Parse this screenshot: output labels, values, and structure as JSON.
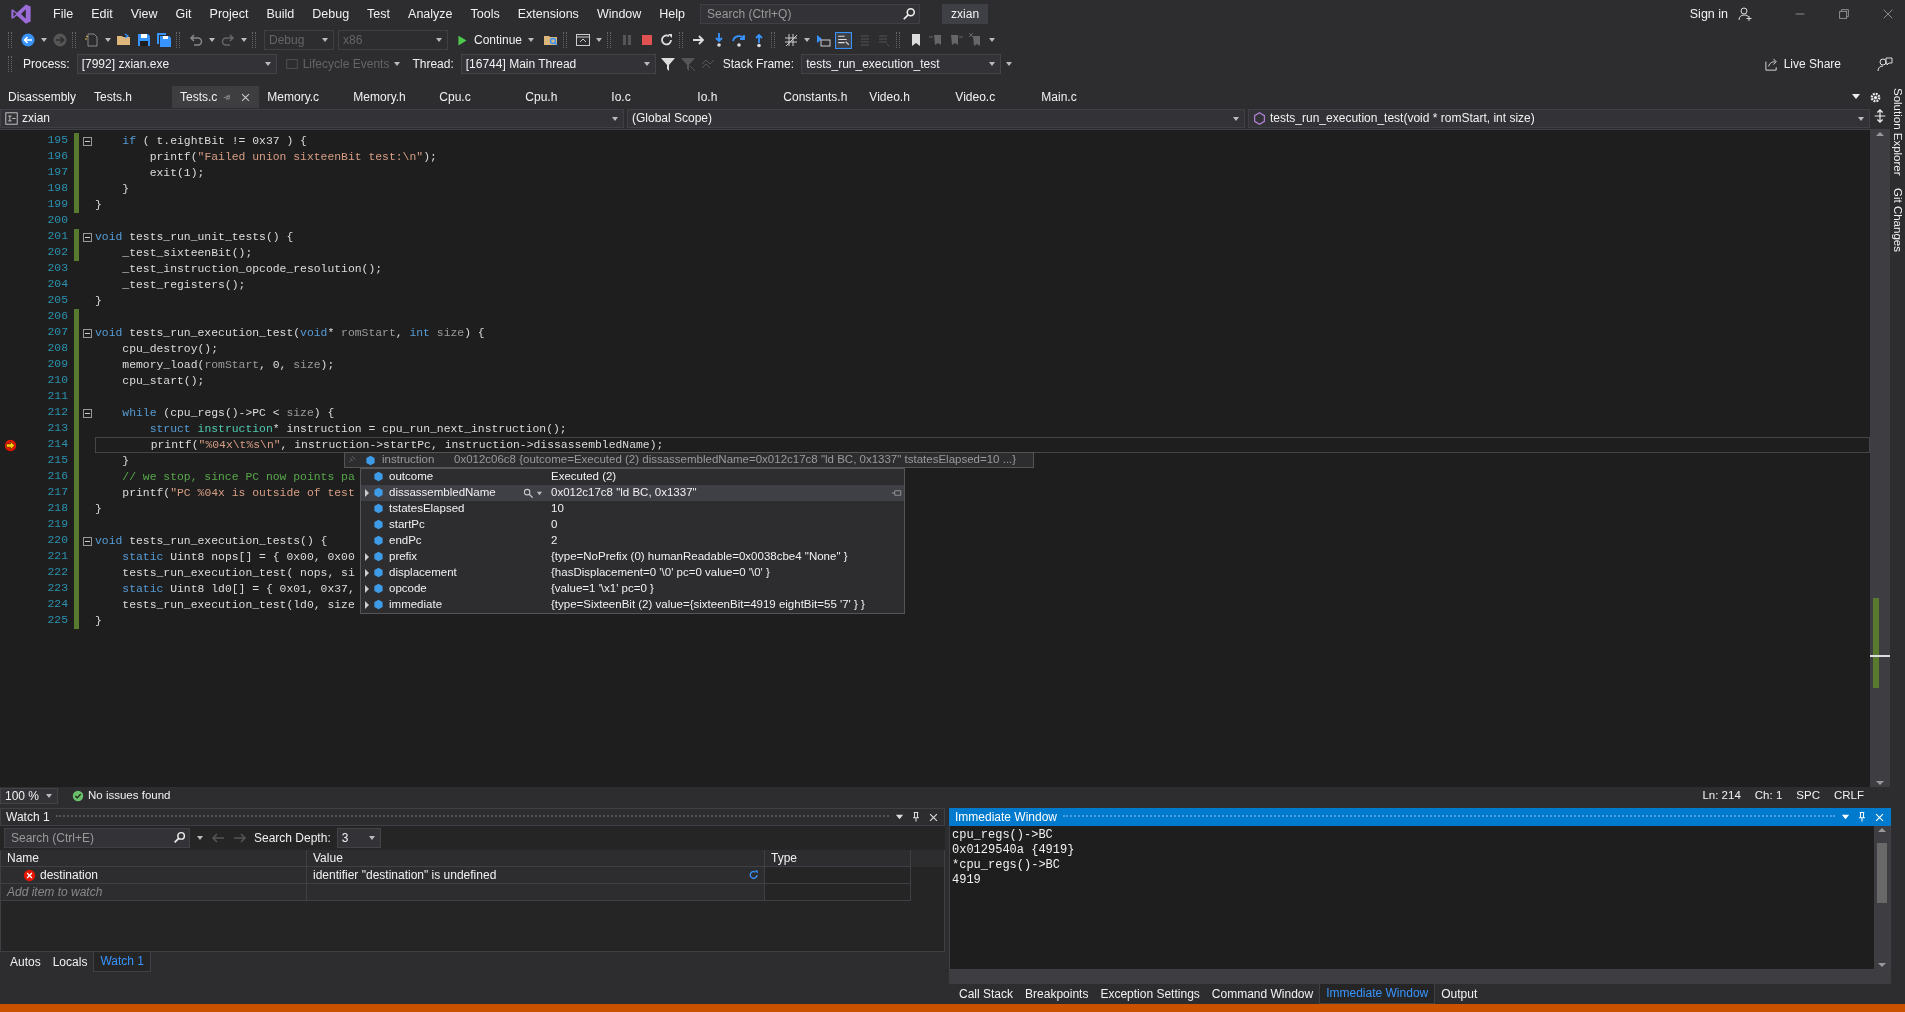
{
  "window": {
    "title": "zxian",
    "search": {
      "placeholder": "Search (Ctrl+Q)"
    },
    "sign_in": "Sign in"
  },
  "menu": [
    "File",
    "Edit",
    "View",
    "Git",
    "Project",
    "Build",
    "Debug",
    "Test",
    "Analyze",
    "Tools",
    "Extensions",
    "Window",
    "Help"
  ],
  "toolbar": {
    "combos": [
      {
        "value": "Debug",
        "disabled": true
      },
      {
        "value": "x86",
        "disabled": true
      }
    ],
    "continue": "Continue"
  },
  "debug_location": {
    "process": {
      "label": "Process:",
      "value": "[7992] zxian.exe"
    },
    "lifecycle": {
      "text": "Lifecycle Events",
      "disabled": true
    },
    "thread": {
      "label": "Thread:",
      "value": "[16744] Main Thread"
    },
    "stack_frame": {
      "label": "Stack Frame:",
      "value": "tests_run_execution_test"
    }
  },
  "live_share": "Live Share",
  "tabs": [
    {
      "label": "Disassembly",
      "selected": false
    },
    {
      "label": "Tests.h",
      "selected": false
    },
    {
      "label": "Tests.c",
      "selected": true
    },
    {
      "label": "Memory.c",
      "selected": false
    },
    {
      "label": "Memory.h",
      "selected": false
    },
    {
      "label": "Cpu.c",
      "selected": false
    },
    {
      "label": "Cpu.h",
      "selected": false
    },
    {
      "label": "Io.c",
      "selected": false
    },
    {
      "label": "Io.h",
      "selected": false
    },
    {
      "label": "Constants.h",
      "selected": false
    },
    {
      "label": "Video.h",
      "selected": false
    },
    {
      "label": "Video.c",
      "selected": false
    },
    {
      "label": "Main.c",
      "selected": false
    }
  ],
  "side_tabs": [
    "Solution Explorer",
    "Git Changes"
  ],
  "nav_bar": {
    "project": "zxian",
    "scope": "(Global Scope)",
    "member": "tests_run_execution_test(void * romStart, int size)"
  },
  "editor": {
    "lines": [
      {
        "no": "195",
        "changed": true,
        "fold": true,
        "breakpoint": false,
        "current": false,
        "code": [
          {
            "kind": "keyword",
            "text": "    if"
          },
          {
            "kind": "plain",
            "text": " ( t.eightBit != 0x37 ) {"
          }
        ]
      },
      {
        "no": "196",
        "changed": true,
        "fold": false,
        "breakpoint": false,
        "current": false,
        "code": [
          {
            "kind": "plain",
            "text": "        printf("
          },
          {
            "kind": "string",
            "text": "\"Failed union sixteenBit test:\\n\""
          },
          {
            "kind": "plain",
            "text": ");"
          }
        ]
      },
      {
        "no": "197",
        "changed": true,
        "fold": false,
        "breakpoint": false,
        "current": false,
        "code": [
          {
            "kind": "plain",
            "text": "        exit(1);"
          }
        ]
      },
      {
        "no": "198",
        "changed": true,
        "fold": false,
        "breakpoint": false,
        "current": false,
        "code": [
          {
            "kind": "plain",
            "text": "    }"
          }
        ]
      },
      {
        "no": "199",
        "changed": true,
        "fold": false,
        "breakpoint": false,
        "current": false,
        "code": [
          {
            "kind": "plain",
            "text": "}"
          }
        ]
      },
      {
        "no": "200",
        "changed": false,
        "fold": false,
        "breakpoint": false,
        "current": false
      },
      {
        "no": "201",
        "changed": true,
        "fold": true,
        "breakpoint": false,
        "current": false,
        "code": [
          {
            "kind": "keyword",
            "text": "void"
          },
          {
            "kind": "plain",
            "text": " tests_run_unit_tests() {"
          }
        ]
      },
      {
        "no": "202",
        "changed": true,
        "fold": false,
        "breakpoint": false,
        "current": false,
        "code": [
          {
            "kind": "plain",
            "text": "    _test_sixteenBit();"
          }
        ]
      },
      {
        "no": "203",
        "changed": false,
        "fold": false,
        "breakpoint": false,
        "current": false,
        "code": [
          {
            "kind": "plain",
            "text": "    _test_instruction_opcode_resolution();"
          }
        ]
      },
      {
        "no": "204",
        "changed": false,
        "fold": false,
        "breakpoint": false,
        "current": false,
        "code": [
          {
            "kind": "plain",
            "text": "    _test_registers();"
          }
        ]
      },
      {
        "no": "205",
        "changed": false,
        "fold": false,
        "breakpoint": false,
        "current": false,
        "code": [
          {
            "kind": "plain",
            "text": "}"
          }
        ]
      },
      {
        "no": "206",
        "changed": true,
        "fold": false,
        "breakpoint": false,
        "current": false
      },
      {
        "no": "207",
        "changed": true,
        "fold": true,
        "breakpoint": false,
        "current": false,
        "code": [
          {
            "kind": "keyword",
            "text": "void"
          },
          {
            "kind": "plain",
            "text": " tests_run_execution_test("
          },
          {
            "kind": "keyword",
            "text": "void"
          },
          {
            "kind": "plain",
            "text": "* "
          },
          {
            "kind": "param",
            "text": "romStart"
          },
          {
            "kind": "plain",
            "text": ", "
          },
          {
            "kind": "keyword",
            "text": "int "
          },
          {
            "kind": "param",
            "text": "size"
          },
          {
            "kind": "plain",
            "text": ") {"
          }
        ]
      },
      {
        "no": "208",
        "changed": true,
        "fold": false,
        "breakpoint": false,
        "current": false,
        "code": [
          {
            "kind": "plain",
            "text": "    cpu_destroy();"
          }
        ]
      },
      {
        "no": "209",
        "changed": true,
        "fold": false,
        "breakpoint": false,
        "current": false,
        "code": [
          {
            "kind": "plain",
            "text": "    memory_load("
          },
          {
            "kind": "param",
            "text": "romStart"
          },
          {
            "kind": "plain",
            "text": ", 0, "
          },
          {
            "kind": "param",
            "text": "size"
          },
          {
            "kind": "plain",
            "text": ");"
          }
        ]
      },
      {
        "no": "210",
        "changed": true,
        "fold": false,
        "breakpoint": false,
        "current": false,
        "code": [
          {
            "kind": "plain",
            "text": "    cpu_start();"
          }
        ]
      },
      {
        "no": "211",
        "changed": true,
        "fold": false,
        "breakpoint": false,
        "current": false
      },
      {
        "no": "212",
        "changed": true,
        "fold": true,
        "breakpoint": false,
        "current": false,
        "code": [
          {
            "kind": "keyword",
            "text": "    while"
          },
          {
            "kind": "plain",
            "text": " (cpu_regs()->PC < "
          },
          {
            "kind": "param",
            "text": "size"
          },
          {
            "kind": "plain",
            "text": ") {"
          }
        ]
      },
      {
        "no": "213",
        "changed": true,
        "fold": false,
        "breakpoint": false,
        "current": false,
        "code": [
          {
            "kind": "keyword",
            "text": "        struct "
          },
          {
            "kind": "type",
            "text": "instruction"
          },
          {
            "kind": "plain",
            "text": "* instruction = cpu_run_next_instruction();"
          }
        ]
      },
      {
        "no": "214",
        "changed": true,
        "fold": false,
        "breakpoint": true,
        "current": true,
        "code": [
          {
            "kind": "plain",
            "text": "        printf("
          },
          {
            "kind": "string",
            "text": "\"%04x\\t%s\\n\""
          },
          {
            "kind": "plain",
            "text": ", instruction->startPc, instruction->dissassembledName);"
          }
        ]
      },
      {
        "no": "215",
        "changed": true,
        "fold": false,
        "breakpoint": false,
        "current": false,
        "code": [
          {
            "kind": "plain",
            "text": "    }"
          }
        ]
      },
      {
        "no": "216",
        "changed": true,
        "fold": false,
        "breakpoint": false,
        "current": false,
        "code": [
          {
            "kind": "comment",
            "text": "    // we stop, since PC now points pa"
          }
        ]
      },
      {
        "no": "217",
        "changed": true,
        "fold": false,
        "breakpoint": false,
        "current": false,
        "code": [
          {
            "kind": "plain",
            "text": "    printf("
          },
          {
            "kind": "string",
            "text": "\"PC %04x is outside of test"
          }
        ]
      },
      {
        "no": "218",
        "changed": true,
        "fold": false,
        "breakpoint": false,
        "current": false,
        "code": [
          {
            "kind": "plain",
            "text": "}"
          }
        ]
      },
      {
        "no": "219",
        "changed": true,
        "fold": false,
        "breakpoint": false,
        "current": false
      },
      {
        "no": "220",
        "changed": true,
        "fold": true,
        "breakpoint": false,
        "current": false,
        "code": [
          {
            "kind": "keyword",
            "text": "void"
          },
          {
            "kind": "plain",
            "text": " tests_run_execution_tests() {"
          }
        ]
      },
      {
        "no": "221",
        "changed": true,
        "fold": false,
        "breakpoint": false,
        "current": false,
        "code": [
          {
            "kind": "keyword",
            "text": "    static"
          },
          {
            "kind": "plain",
            "text": " Uint8 nops[] = { 0x00, 0x00"
          }
        ]
      },
      {
        "no": "222",
        "changed": true,
        "fold": false,
        "breakpoint": false,
        "current": false,
        "code": [
          {
            "kind": "plain",
            "text": "    tests_run_execution_test( nops, si"
          }
        ]
      },
      {
        "no": "223",
        "changed": true,
        "fold": false,
        "breakpoint": false,
        "current": false,
        "code": [
          {
            "kind": "keyword",
            "text": "    static"
          },
          {
            "kind": "plain",
            "text": " Uint8 ld0[] = { 0x01, 0x37,"
          }
        ]
      },
      {
        "no": "224",
        "changed": true,
        "fold": false,
        "breakpoint": false,
        "current": false,
        "code": [
          {
            "kind": "plain",
            "text": "    tests_run_execution_test(ld0, size"
          }
        ]
      },
      {
        "no": "225",
        "changed": true,
        "fold": false,
        "breakpoint": false,
        "current": false,
        "code": [
          {
            "kind": "plain",
            "text": "}"
          }
        ]
      }
    ]
  },
  "datatip": {
    "expression": "instruction",
    "summary": "0x012c06c8 {outcome=Executed (2) dissassembledName=0x012c17c8 \"ld BC, 0x1337\" tstatesElapsed=10 ...}",
    "members": [
      {
        "name": "outcome",
        "value": "Executed (2)",
        "expandable": false,
        "selected": false
      },
      {
        "name": "dissassembledName",
        "value": "0x012c17c8 \"ld BC, 0x1337\"",
        "expandable": true,
        "selected": true
      },
      {
        "name": "tstatesElapsed",
        "value": "10",
        "expandable": false,
        "selected": false
      },
      {
        "name": "startPc",
        "value": "0",
        "expandable": false,
        "selected": false
      },
      {
        "name": "endPc",
        "value": "2",
        "expandable": false,
        "selected": false
      },
      {
        "name": "prefix",
        "value": "{type=NoPrefix (0) humanReadable=0x0038cbe4 \"None\" }",
        "expandable": true,
        "selected": false
      },
      {
        "name": "displacement",
        "value": "{hasDisplacement=0 '\\0' pc=0 value=0 '\\0' }",
        "expandable": true,
        "selected": false
      },
      {
        "name": "opcode",
        "value": "{value=1 '\\x1' pc=0 }",
        "expandable": true,
        "selected": false
      },
      {
        "name": "immediate",
        "value": "{type=SixteenBit (2) value={sixteenBit=4919 eightBit=55 '7' } }",
        "expandable": true,
        "selected": false
      }
    ]
  },
  "editor_status": {
    "zoom": "100 %",
    "issues": "No issues found",
    "ln": "Ln: 214",
    "ch": "Ch: 1",
    "indent": "SPC",
    "eol": "CRLF"
  },
  "watch": {
    "title": "Watch 1",
    "search": {
      "placeholder": "Search (Ctrl+E)"
    },
    "depth_label": "Search Depth:",
    "depth": "3",
    "columns": [
      "Name",
      "Value",
      "Type"
    ],
    "rows": [
      {
        "name": "destination",
        "value": "identifier \"destination\" is undefined",
        "error": true
      }
    ],
    "add_placeholder": "Add item to watch",
    "tabs": [
      {
        "label": "Autos",
        "selected": false
      },
      {
        "label": "Locals",
        "selected": false
      },
      {
        "label": "Watch 1",
        "selected": true
      }
    ]
  },
  "immediate": {
    "title": "Immediate Window",
    "active": true,
    "lines": [
      "cpu_regs()->BC",
      "0x0129540a {4919}",
      "*cpu_regs()->BC",
      "4919"
    ],
    "tabs": [
      {
        "label": "Call Stack",
        "selected": false
      },
      {
        "label": "Breakpoints",
        "selected": false
      },
      {
        "label": "Exception Settings",
        "selected": false
      },
      {
        "label": "Command Window",
        "selected": false
      },
      {
        "label": "Immediate Window",
        "selected": true
      },
      {
        "label": "Output",
        "selected": false
      }
    ]
  }
}
